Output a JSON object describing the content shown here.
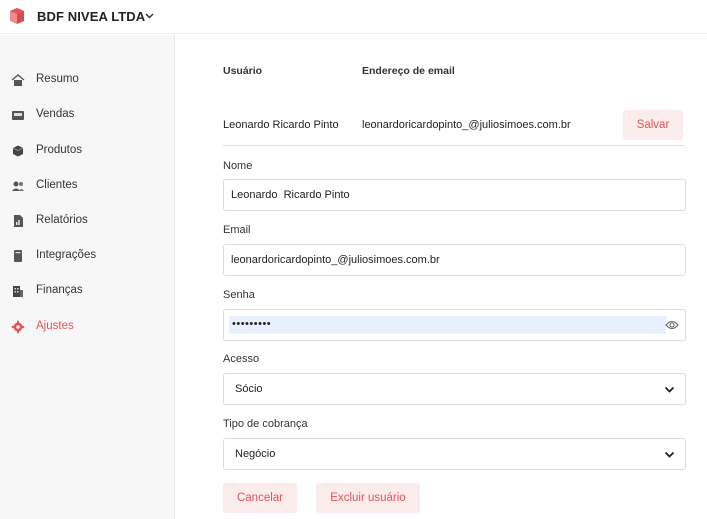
{
  "header": {
    "company_name": "BDF NIVEA LTDA",
    "logo_icon": "box-logo-icon",
    "brand_color": "#e0555a"
  },
  "sidebar": {
    "items": [
      {
        "label": "Resumo",
        "icon": "home-icon",
        "active": false
      },
      {
        "label": "Vendas",
        "icon": "cash-register-icon",
        "active": false
      },
      {
        "label": "Produtos",
        "icon": "cube-icon",
        "active": false
      },
      {
        "label": "Clientes",
        "icon": "users-icon",
        "active": false
      },
      {
        "label": "Relatórios",
        "icon": "file-chart-icon",
        "active": false
      },
      {
        "label": "Integrações",
        "icon": "book-icon",
        "active": false
      },
      {
        "label": "Finanças",
        "icon": "building-icon",
        "active": false
      },
      {
        "label": "Ajustes",
        "icon": "gear-icon",
        "active": true
      }
    ]
  },
  "user_table": {
    "headers": {
      "user": "Usuário",
      "email": "Endereço de email"
    },
    "row": {
      "user": "Leonardo Ricardo Pinto",
      "email": "leonardoricardopinto_@juliosimoes.com.br"
    },
    "save_label": "Salvar"
  },
  "form": {
    "name_label": "Nome",
    "name_value": "Leonardo  Ricardo Pinto",
    "email_label": "Email",
    "email_value": "leonardoricardopinto_@juliosimoes.com.br",
    "password_label": "Senha",
    "password_value": "•••••••••",
    "access_label": "Acesso",
    "access_value": "Sócio",
    "billing_label": "Tipo de cobrança",
    "billing_value": "Negócio",
    "cancel_label": "Cancelar",
    "delete_label": "Excluir usuário"
  }
}
